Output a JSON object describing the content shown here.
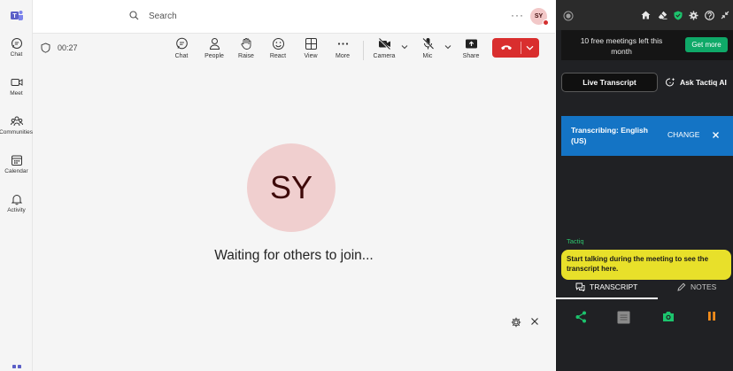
{
  "rail": {
    "items": [
      {
        "label": "Chat",
        "icon": "chat-icon"
      },
      {
        "label": "Meet",
        "icon": "video-icon"
      },
      {
        "label": "Communities",
        "icon": "people-group-icon"
      },
      {
        "label": "Calendar",
        "icon": "calendar-icon"
      },
      {
        "label": "Activity",
        "icon": "bell-icon"
      }
    ]
  },
  "titlebar": {
    "search_placeholder": "Search",
    "more": "···",
    "user_initials": "SY"
  },
  "meeting": {
    "timer": "00:27",
    "toolbar": [
      {
        "label": "Chat"
      },
      {
        "label": "People"
      },
      {
        "label": "Raise"
      },
      {
        "label": "React"
      },
      {
        "label": "View"
      },
      {
        "label": "More"
      },
      {
        "label": "Camera"
      },
      {
        "label": "Mic"
      },
      {
        "label": "Share"
      }
    ],
    "avatar_initials": "SY",
    "waiting_text": "Waiting for others to join..."
  },
  "tactiq": {
    "promo_text": "10 free meetings left this month",
    "get_more": "Get more",
    "tab_live": "Live Transcript",
    "tab_ask": "Ask Tactiq AI",
    "transcribing_text": "Transcribing: English (US)",
    "change": "CHANGE",
    "speaker": "Tactiq",
    "hint": "Start talking during the meeting to see the transcript here.",
    "tab_transcript": "TRANSCRIPT",
    "tab_notes": "NOTES"
  },
  "colors": {
    "teams_accent": "#5b5fc7",
    "leave_red": "#d92e2e",
    "avatar_bg": "#f0cfcf",
    "tactiq_green": "#0fa968",
    "transcribing_blue": "#1474c5",
    "hint_yellow": "#e8e02a",
    "action_orange": "#f28c1b"
  }
}
